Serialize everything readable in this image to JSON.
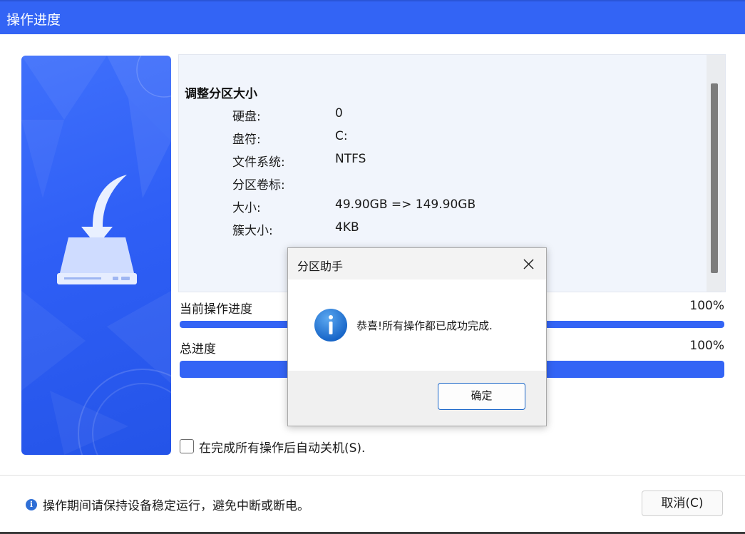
{
  "window": {
    "title": "操作进度"
  },
  "operation": {
    "heading": "调整分区大小",
    "rows": [
      {
        "key": "硬盘:",
        "value": "0"
      },
      {
        "key": "盘符:",
        "value": "C:"
      },
      {
        "key": "文件系统:",
        "value": "NTFS"
      },
      {
        "key": "分区卷标:",
        "value": ""
      },
      {
        "key": "大小:",
        "value": "49.90GB => 149.90GB"
      },
      {
        "key": "簇大小:",
        "value": "4KB"
      }
    ]
  },
  "progress": {
    "current_label": "当前操作进度",
    "current_percent": "100%",
    "current_fraction": 1.0,
    "total_label": "总进度",
    "total_percent": "100%",
    "total_fraction": 1.0
  },
  "shutdown_option": {
    "label": "在完成所有操作后自动关机(S).",
    "checked": false
  },
  "footer": {
    "note": "操作期间请保持设备稳定运行，避免中断或断电。",
    "cancel_label": "取消(C)"
  },
  "dialog": {
    "title": "分区助手",
    "message": "恭喜!所有操作都已成功完成.",
    "ok_label": "确定",
    "icon": "info-icon"
  },
  "colors": {
    "accent": "#3364f5",
    "progress_track": "#dfe7fb",
    "info_icon": "#1b73d2"
  }
}
